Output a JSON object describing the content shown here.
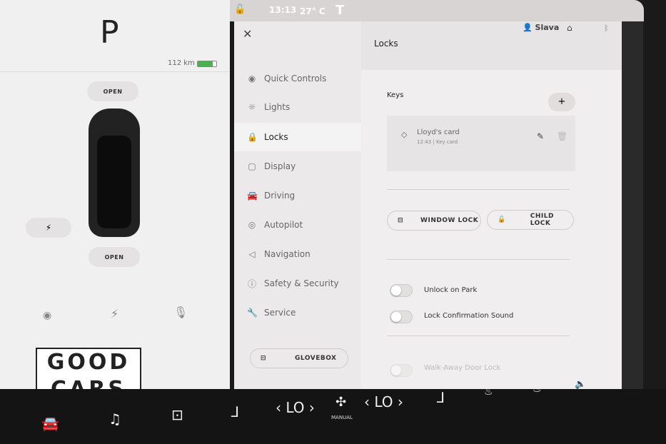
{
  "car": {
    "gear": "P",
    "range": "112 km",
    "front_trunk": "OPEN",
    "rear_trunk": "OPEN"
  },
  "status": {
    "time": "13:13",
    "temp": "27° C",
    "user": "Slava"
  },
  "menu": {
    "items": [
      {
        "label": "Quick Controls",
        "icon": "eye-icon"
      },
      {
        "label": "Lights",
        "icon": "light-icon"
      },
      {
        "label": "Locks",
        "icon": "lock-icon",
        "active": true
      },
      {
        "label": "Display",
        "icon": "display-icon"
      },
      {
        "label": "Driving",
        "icon": "car-icon"
      },
      {
        "label": "Autopilot",
        "icon": "steering-wheel-icon"
      },
      {
        "label": "Navigation",
        "icon": "navigation-icon"
      },
      {
        "label": "Safety & Security",
        "icon": "alert-icon"
      },
      {
        "label": "Service",
        "icon": "wrench-icon"
      }
    ],
    "glovebox": "GLOVEBOX"
  },
  "content": {
    "title": "Locks",
    "keys_label": "Keys",
    "add": "+",
    "key": {
      "name": "Lloyd's card",
      "detail": "12:43 | Key card"
    },
    "window_lock": "WINDOW LOCK",
    "child_lock": "CHILD LOCK",
    "toggles": [
      {
        "label": "Unlock on Park",
        "on": false
      },
      {
        "label": "Lock Confirmation Sound",
        "on": false
      },
      {
        "label": "Walk-Away Door Lock",
        "on": false
      }
    ]
  },
  "bottom": {
    "temp_left": "LO",
    "temp_right": "LO",
    "fan_mode": "MANUAL"
  },
  "watermark": "GOOD CARS"
}
